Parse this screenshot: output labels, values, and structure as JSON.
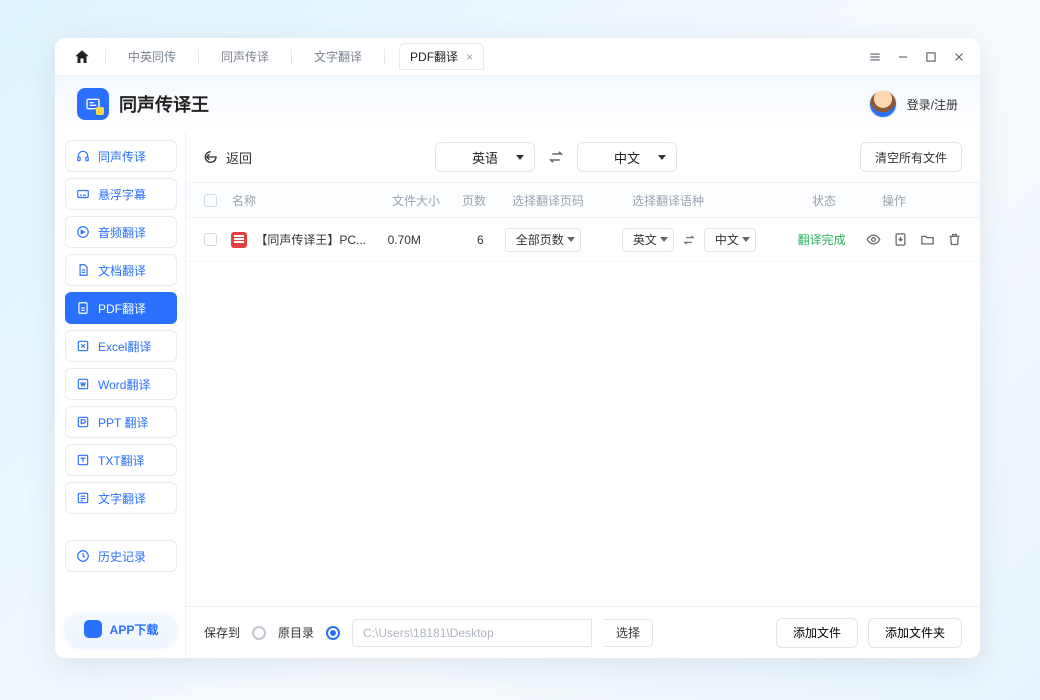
{
  "titlebar": {
    "tabs": [
      "中英同传",
      "同声传译",
      "文字翻译"
    ],
    "active_tab": "PDF翻译"
  },
  "header": {
    "brand": "同声传译王",
    "login": "登录/注册"
  },
  "sidebar": {
    "items": [
      {
        "label": "同声传译"
      },
      {
        "label": "悬浮字幕"
      },
      {
        "label": "音频翻译"
      },
      {
        "label": "文档翻译"
      },
      {
        "label": "PDF翻译"
      },
      {
        "label": "Excel翻译"
      },
      {
        "label": "Word翻译"
      },
      {
        "label": "PPT 翻译"
      },
      {
        "label": "TXT翻译"
      },
      {
        "label": "文字翻译"
      }
    ],
    "history": "历史记录",
    "app_download": "APP下载"
  },
  "toolbar": {
    "back": "返回",
    "src_lang": "英语",
    "dst_lang": "中文",
    "clear_all": "清空所有文件"
  },
  "table": {
    "headers": {
      "name": "名称",
      "size": "文件大小",
      "pages": "页数",
      "range": "选择翻译页码",
      "lang": "选择翻译语种",
      "status": "状态",
      "ops": "操作"
    },
    "row": {
      "name": "【同声传译王】PC...",
      "size": "0.70M",
      "pages": "6",
      "range": "全部页数",
      "src": "英文",
      "dst": "中文",
      "status": "翻译完成"
    }
  },
  "footer": {
    "save_to": "保存到",
    "orig_dir": "原目录",
    "path": "C:\\Users\\18181\\Desktop",
    "choose": "选择",
    "add_file": "添加文件",
    "add_folder": "添加文件夹"
  }
}
